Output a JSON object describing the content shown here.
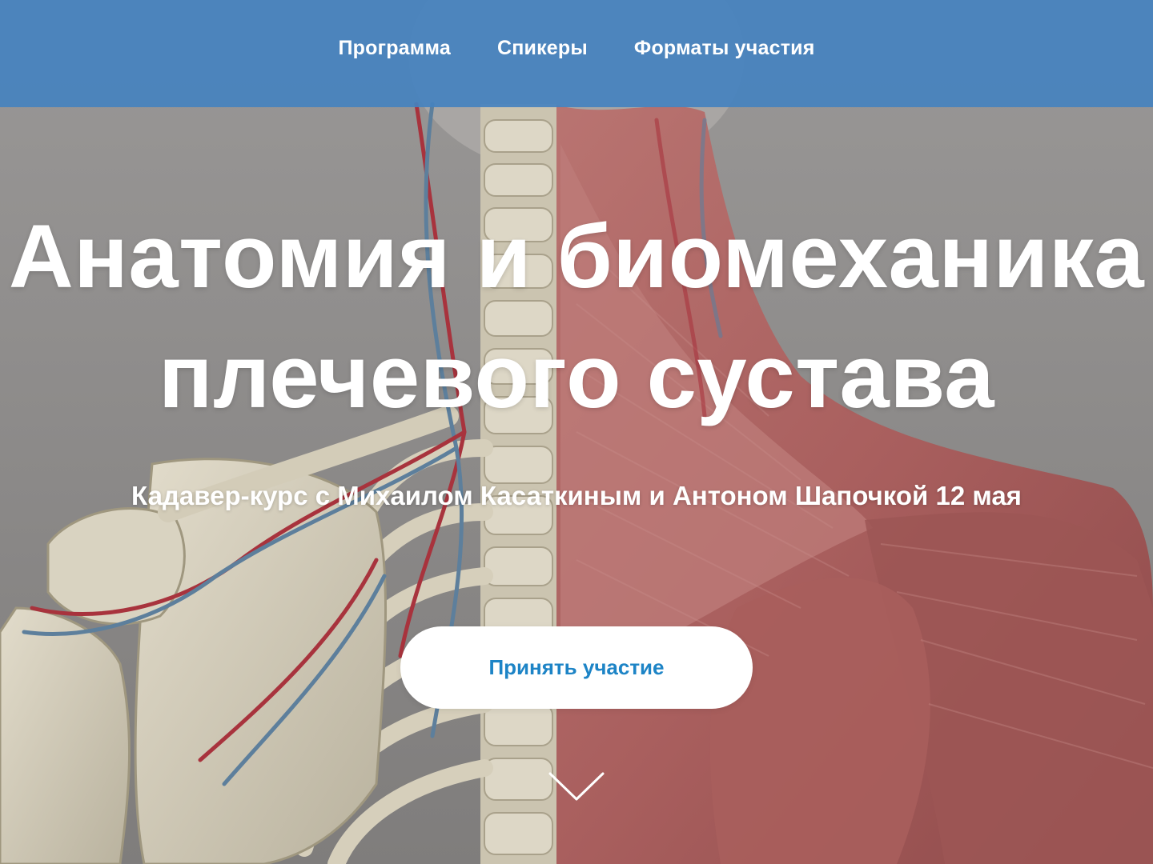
{
  "nav": {
    "items": [
      {
        "label": "Программа"
      },
      {
        "label": "Спикеры"
      },
      {
        "label": "Форматы участия"
      }
    ]
  },
  "hero": {
    "title_line1": "Анатомия и биомеханика",
    "title_line2": "плечевого сустава",
    "subtitle": "Кадавер-курс с Михаилом Касаткиным и Антоном Шапочкой 12 мая",
    "cta_label": "Принять участие",
    "scroll_icon": "chevron-down-icon"
  },
  "colors": {
    "nav_bg": "#4682be",
    "cta_text": "#1d84c6",
    "muscle": "#b06a68",
    "bone": "#d8d2c0",
    "background": "#8d8b8a"
  }
}
